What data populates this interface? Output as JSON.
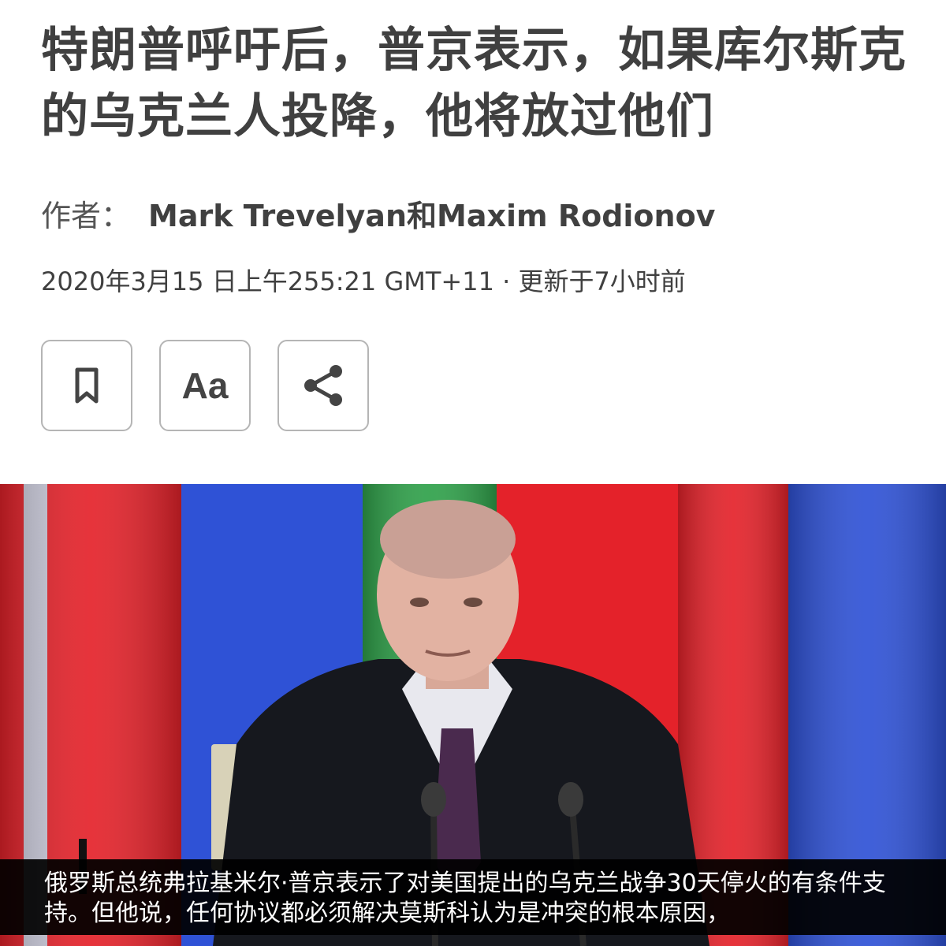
{
  "article": {
    "headline": "特朗普呼吁后，普京表示，如果库尔斯克的乌克兰人投降，他将放过他们",
    "byline_label": "作者：",
    "authors": "Mark Trevelyan和Maxim Rodionov",
    "dateline": "2020年3月15 日上午255:21 GMT+11 · 更新于7小时前"
  },
  "toolbar": {
    "bookmark_icon": "bookmark-icon",
    "text_size_label": "Aa",
    "share_icon": "share-icon"
  },
  "photo": {
    "caption": "俄罗斯总统弗拉基米尔·普京表示了对美国提出的乌克兰战争30天停火的有条件支持。但他说，任何协议都必须解决莫斯科认为是冲突的根本原因，"
  },
  "colors": {
    "text": "#404040",
    "button_border": "#b5b5b5",
    "flag_red": "#e4222a",
    "flag_blue": "#2f52d6",
    "flag_green": "#2fa14a",
    "caption_bg": "#000000"
  }
}
